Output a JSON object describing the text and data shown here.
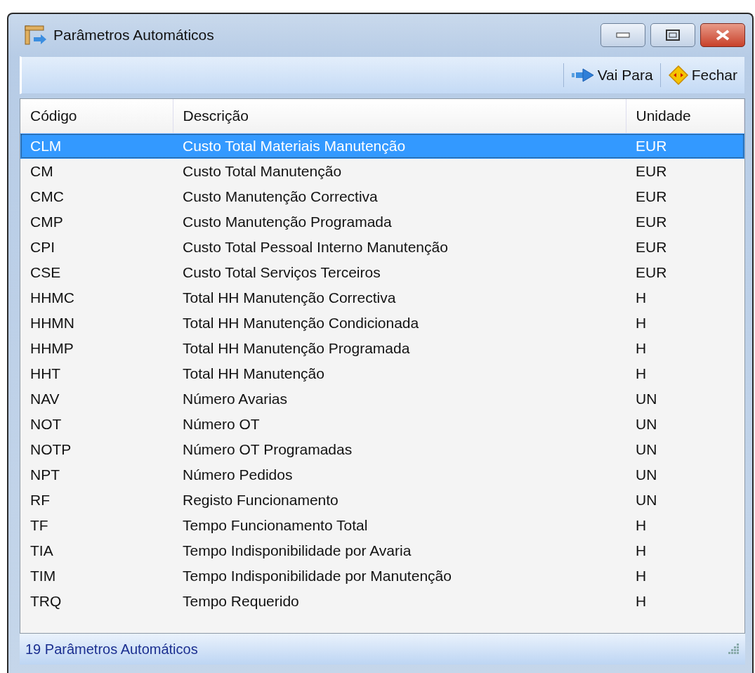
{
  "window": {
    "title": "Parâmetros Automáticos"
  },
  "toolbar": {
    "buttons": [
      {
        "label": "Vai Para",
        "kind": "goto"
      },
      {
        "label": "Fechar",
        "kind": "close"
      }
    ]
  },
  "table": {
    "columns": [
      "Código",
      "Descrição",
      "Unidade"
    ],
    "rows": [
      {
        "cells": [
          "CLM",
          "Custo Total Materiais Manutenção",
          "EUR"
        ],
        "selected": true
      },
      {
        "cells": [
          "CM",
          "Custo Total Manutenção",
          "EUR"
        ],
        "selected": false
      },
      {
        "cells": [
          "CMC",
          "Custo Manutenção Correctiva",
          "EUR"
        ],
        "selected": false
      },
      {
        "cells": [
          "CMP",
          "Custo Manutenção Programada",
          "EUR"
        ],
        "selected": false
      },
      {
        "cells": [
          "CPI",
          "Custo Total Pessoal Interno Manutenção",
          "EUR"
        ],
        "selected": false
      },
      {
        "cells": [
          "CSE",
          "Custo Total Serviços Terceiros",
          "EUR"
        ],
        "selected": false
      },
      {
        "cells": [
          "HHMC",
          "Total HH Manutenção Correctiva",
          "H"
        ],
        "selected": false
      },
      {
        "cells": [
          "HHMN",
          "Total HH Manutenção Condicionada",
          "H"
        ],
        "selected": false
      },
      {
        "cells": [
          "HHMP",
          "Total HH Manutenção Programada",
          "H"
        ],
        "selected": false
      },
      {
        "cells": [
          "HHT",
          "Total HH Manutenção",
          "H"
        ],
        "selected": false
      },
      {
        "cells": [
          "NAV",
          "Número Avarias",
          "UN"
        ],
        "selected": false
      },
      {
        "cells": [
          "NOT",
          "Número OT",
          "UN"
        ],
        "selected": false
      },
      {
        "cells": [
          "NOTP",
          "Número OT Programadas",
          "UN"
        ],
        "selected": false
      },
      {
        "cells": [
          "NPT",
          "Número Pedidos",
          "UN"
        ],
        "selected": false
      },
      {
        "cells": [
          "RF",
          "Registo Funcionamento",
          "UN"
        ],
        "selected": false
      },
      {
        "cells": [
          "TF",
          "Tempo Funcionamento Total",
          "H"
        ],
        "selected": false
      },
      {
        "cells": [
          "TIA",
          "Tempo Indisponibilidade por Avaria",
          "H"
        ],
        "selected": false
      },
      {
        "cells": [
          "TIM",
          "Tempo Indisponibilidade por Manutenção",
          "H"
        ],
        "selected": false
      },
      {
        "cells": [
          "TRQ",
          "Tempo Requerido",
          "H"
        ],
        "selected": false
      }
    ]
  },
  "status_bar": "19 Parâmetros Automáticos"
}
